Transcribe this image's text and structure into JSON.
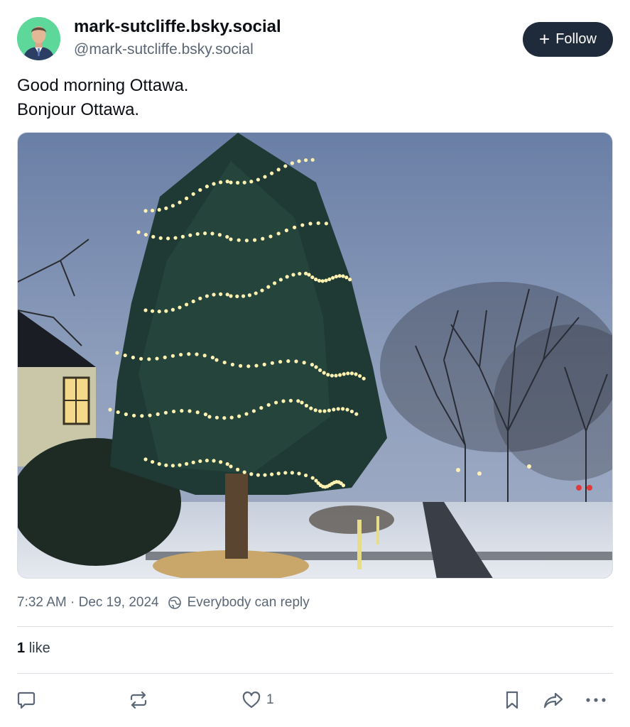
{
  "author": {
    "display_name": "mark-sutcliffe.bsky.social",
    "handle": "@mark-sutcliffe.bsky.social"
  },
  "follow_button": {
    "icon": "plus-icon",
    "label": "Follow"
  },
  "post": {
    "lines": [
      "Good morning Ottawa.",
      "Bonjour Ottawa."
    ]
  },
  "meta": {
    "timestamp": "7:32 AM · Dec 19, 2024",
    "reply_setting": "Everybody can reply",
    "reply_icon": "globe-icon"
  },
  "likes": {
    "count": "1",
    "label": "like"
  },
  "actions": {
    "reply_icon": "speech-bubble-icon",
    "repost_icon": "repost-icon",
    "like_icon": "heart-icon",
    "like_count": "1",
    "bookmark_icon": "bookmark-icon",
    "share_icon": "share-arrow-icon",
    "more_icon": "ellipsis-icon"
  },
  "colors": {
    "follow_bg": "#1f2a3a",
    "muted_text": "#5b6776",
    "divider": "#d9dee5",
    "avatar_bg": "#5ed89a"
  }
}
